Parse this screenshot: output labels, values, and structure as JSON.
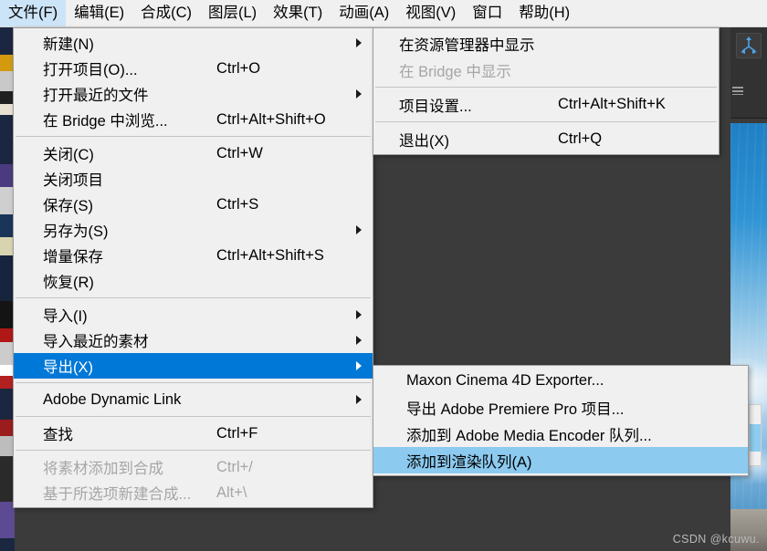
{
  "menubar": {
    "items": [
      {
        "label": "文件(F)",
        "active": true
      },
      {
        "label": "编辑(E)",
        "active": false
      },
      {
        "label": "合成(C)",
        "active": false
      },
      {
        "label": "图层(L)",
        "active": false
      },
      {
        "label": "效果(T)",
        "active": false
      },
      {
        "label": "动画(A)",
        "active": false
      },
      {
        "label": "视图(V)",
        "active": false
      },
      {
        "label": "窗口",
        "active": false
      },
      {
        "label": "帮助(H)",
        "active": false
      }
    ]
  },
  "file_menu": {
    "groups": [
      {
        "items": [
          {
            "label": "新建(N)",
            "shortcut": "",
            "submenu": true,
            "state": "normal"
          },
          {
            "label": "打开项目(O)...",
            "shortcut": "Ctrl+O",
            "submenu": false,
            "state": "normal"
          },
          {
            "label": "打开最近的文件",
            "shortcut": "",
            "submenu": true,
            "state": "normal"
          },
          {
            "label": "在 Bridge 中浏览...",
            "shortcut": "Ctrl+Alt+Shift+O",
            "submenu": false,
            "state": "normal"
          }
        ]
      },
      {
        "items": [
          {
            "label": "关闭(C)",
            "shortcut": "Ctrl+W",
            "submenu": false,
            "state": "normal"
          },
          {
            "label": "关闭项目",
            "shortcut": "",
            "submenu": false,
            "state": "normal"
          },
          {
            "label": "保存(S)",
            "shortcut": "Ctrl+S",
            "submenu": false,
            "state": "normal"
          },
          {
            "label": "另存为(S)",
            "shortcut": "",
            "submenu": true,
            "state": "normal"
          },
          {
            "label": "增量保存",
            "shortcut": "Ctrl+Alt+Shift+S",
            "submenu": false,
            "state": "normal"
          },
          {
            "label": "恢复(R)",
            "shortcut": "",
            "submenu": false,
            "state": "normal"
          }
        ]
      },
      {
        "items": [
          {
            "label": "导入(I)",
            "shortcut": "",
            "submenu": true,
            "state": "normal"
          },
          {
            "label": "导入最近的素材",
            "shortcut": "",
            "submenu": true,
            "state": "normal"
          },
          {
            "label": "导出(X)",
            "shortcut": "",
            "submenu": true,
            "state": "highlight"
          }
        ]
      },
      {
        "items": [
          {
            "label": "Adobe Dynamic Link",
            "shortcut": "",
            "submenu": true,
            "state": "normal"
          }
        ]
      },
      {
        "items": [
          {
            "label": "查找",
            "shortcut": "Ctrl+F",
            "submenu": false,
            "state": "normal"
          }
        ]
      },
      {
        "items": [
          {
            "label": "将素材添加到合成",
            "shortcut": "Ctrl+/",
            "submenu": false,
            "state": "disabled"
          },
          {
            "label": "基于所选项新建合成...",
            "shortcut": "Alt+\\",
            "submenu": false,
            "state": "disabled"
          }
        ]
      }
    ]
  },
  "top_submenu": {
    "groups": [
      {
        "items": [
          {
            "label": "在资源管理器中显示",
            "shortcut": "",
            "submenu": false,
            "state": "normal"
          },
          {
            "label": "在 Bridge 中显示",
            "shortcut": "",
            "submenu": false,
            "state": "disabled"
          }
        ]
      },
      {
        "items": [
          {
            "label": "项目设置...",
            "shortcut": "Ctrl+Alt+Shift+K",
            "submenu": false,
            "state": "normal"
          }
        ]
      },
      {
        "items": [
          {
            "label": "退出(X)",
            "shortcut": "Ctrl+Q",
            "submenu": false,
            "state": "normal"
          }
        ]
      }
    ]
  },
  "export_submenu": {
    "groups": [
      {
        "items": [
          {
            "label": "Maxon Cinema 4D Exporter...",
            "shortcut": "",
            "submenu": false,
            "state": "normal"
          },
          {
            "label": "导出 Adobe Premiere Pro 项目...",
            "shortcut": "",
            "submenu": false,
            "state": "normal"
          },
          {
            "label": "添加到 Adobe Media Encoder 队列...",
            "shortcut": "",
            "submenu": false,
            "state": "normal"
          },
          {
            "label": "添加到渲染队列(A)",
            "shortcut": "",
            "submenu": false,
            "state": "highlight-soft"
          }
        ]
      }
    ]
  },
  "watermark": {
    "text": "CSDN @kcuwu."
  },
  "colors": {
    "menu_bg": "#f0f0f0",
    "menu_border": "#9c9c9c",
    "highlight_blue": "#0078d7",
    "highlight_soft_blue": "#8ccaf0",
    "menubar_active": "#cce4f7",
    "disabled_text": "#a6a6a6"
  }
}
